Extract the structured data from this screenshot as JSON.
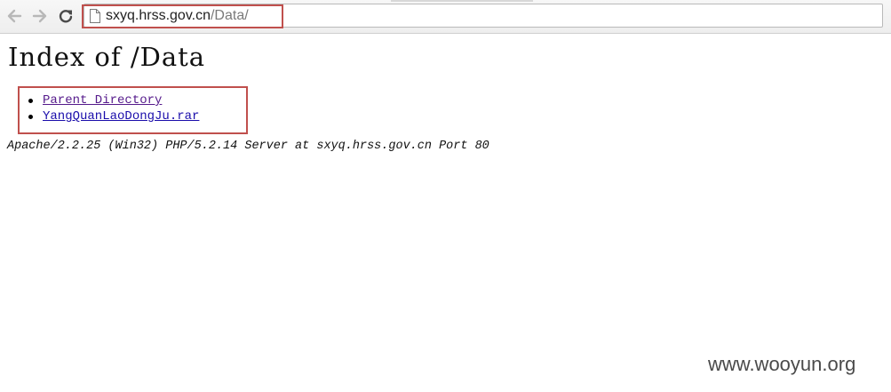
{
  "browser": {
    "address_bar": {
      "host": "sxyq.hrss.gov.cn",
      "path": "/Data/"
    },
    "icons": {
      "back": "arrow-left-icon",
      "forward": "arrow-right-icon",
      "reload": "reload-icon",
      "page": "page-icon"
    }
  },
  "page": {
    "title": "Index of /Data",
    "entries": [
      {
        "label": "Parent Directory"
      },
      {
        "label": "YangQuanLaoDongJu.rar"
      }
    ],
    "server_signature": "Apache/2.2.25 (Win32) PHP/5.2.14 Server at sxyq.hrss.gov.cn Port 80"
  },
  "annotation_color": "#c0504d",
  "watermark": "www.wooyun.org"
}
